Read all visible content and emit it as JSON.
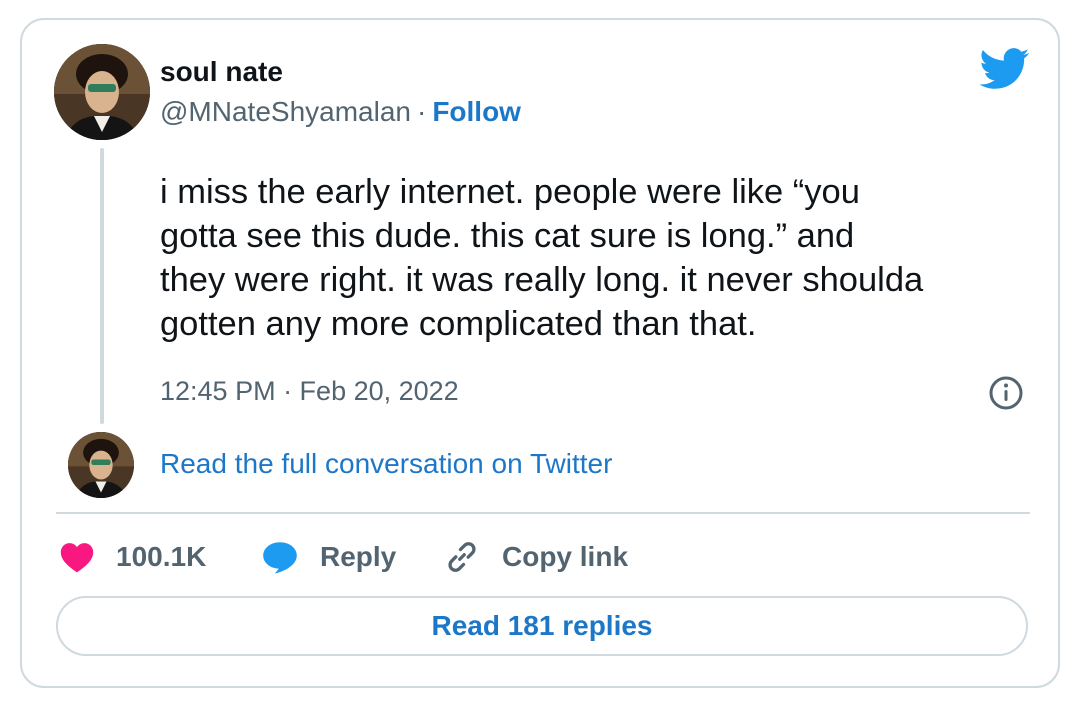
{
  "author": {
    "display_name": "soul nate",
    "handle": "@MNateShyamalan",
    "separator": "·",
    "follow_label": "Follow"
  },
  "tweet": {
    "text": "i miss the early internet. people were like “you\ngotta see this dude. this cat sure is long.” and\nthey were right. it was really long. it never shoulda\ngotten any more complicated than that.",
    "timestamp": "12:45 PM · Feb 20, 2022"
  },
  "conversation_link": "Read the full conversation on Twitter",
  "actions": {
    "likes": "100.1K",
    "reply_label": "Reply",
    "copy_link_label": "Copy link"
  },
  "replies_button": "Read 181 replies",
  "colors": {
    "accent": "#1d77c9",
    "twitter_blue": "#1d9bf0",
    "like_pink": "#f91880",
    "muted": "#536471",
    "border": "#cfd9de"
  },
  "icons": {
    "brand": "twitter-bird-icon",
    "info": "info-icon",
    "like": "heart-icon",
    "reply": "speech-bubble-icon",
    "copy": "link-icon"
  }
}
